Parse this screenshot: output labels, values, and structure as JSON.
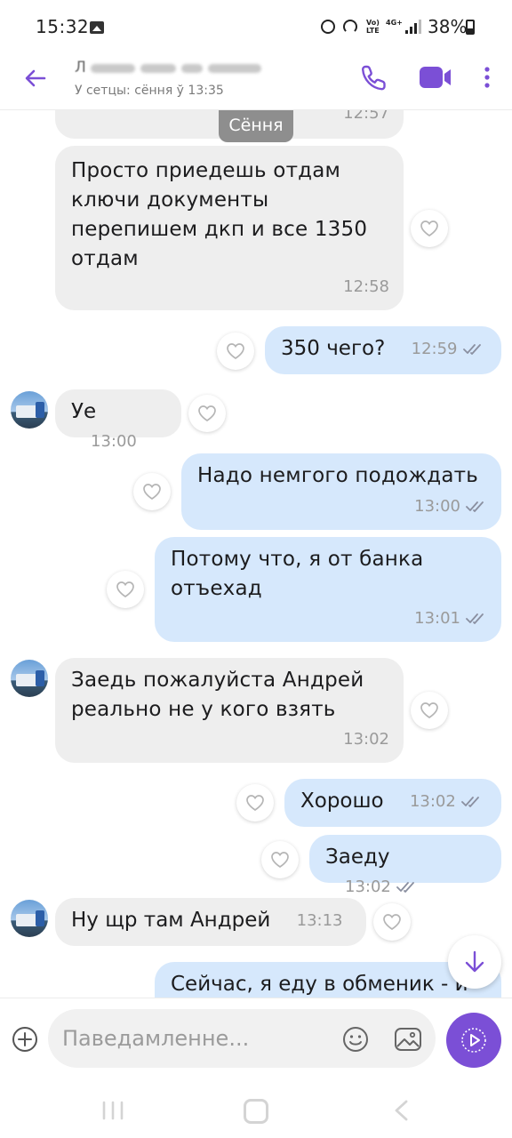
{
  "status_bar": {
    "time": "15:32",
    "volte": "Vo)\nLTE",
    "network": "4G+",
    "battery": "38%"
  },
  "header": {
    "contact_name": "Л",
    "last_seen": "У сетцы: сёння ў 13:35",
    "accent": "#7b4fd6"
  },
  "chat": {
    "date_chip": "Сёння",
    "messages": [
      {
        "dir": "in",
        "text": "",
        "time": "12:57"
      },
      {
        "dir": "in",
        "text": "Просто приедешь отдам ключи документы перепишем дкп и все 1350 отдам",
        "time": "12:58"
      },
      {
        "dir": "out",
        "text": "350 чего?",
        "time": "12:59"
      },
      {
        "dir": "in",
        "text": "Уе",
        "time": "13:00"
      },
      {
        "dir": "out",
        "text": "Надо немгого подождать",
        "time": "13:00"
      },
      {
        "dir": "out",
        "text": "Потому что, я от банка отъехад",
        "time": "13:01"
      },
      {
        "dir": "in",
        "text": "Заедь пожалуйста Андрей реально не у кого взять",
        "time": "13:02"
      },
      {
        "dir": "out",
        "text": "Хорошо",
        "time": "13:02"
      },
      {
        "dir": "out",
        "text": "Заеду",
        "time": "13:02"
      },
      {
        "dir": "in",
        "text": "Ну щр там Андрей",
        "time": "13:13"
      },
      {
        "dir": "out",
        "text": "Сейчас, я еду в обменик - и",
        "time": ""
      }
    ]
  },
  "composer": {
    "placeholder": "Паведамленне..."
  },
  "icons": {
    "back": "arrow-left-icon",
    "call": "phone-icon",
    "video": "video-camera-icon",
    "more": "more-vertical-icon",
    "react": "heart-icon",
    "read": "double-check-icon",
    "scroll": "arrow-down-icon",
    "add": "plus-circle-icon",
    "sticker": "smiley-icon",
    "gallery": "image-icon",
    "send": "play-icon"
  }
}
